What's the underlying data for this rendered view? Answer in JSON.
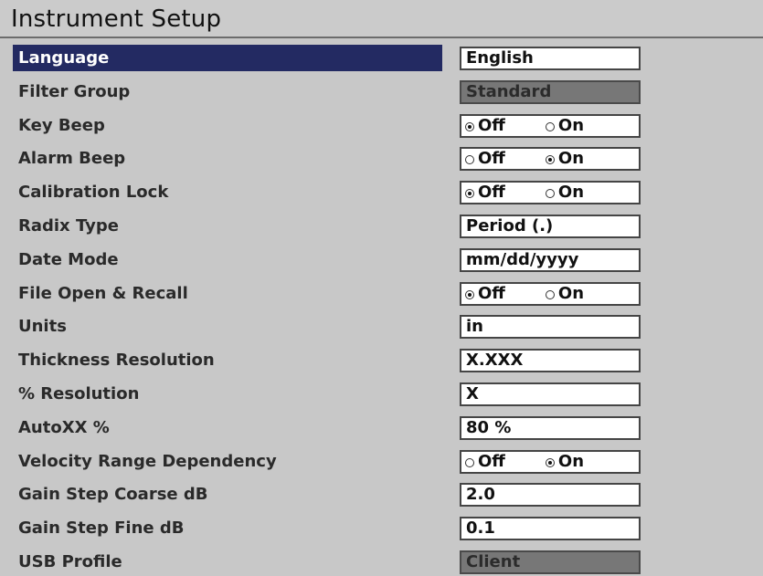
{
  "header": {
    "title": "Instrument Setup"
  },
  "settings": [
    {
      "label": "Language",
      "value": "English",
      "type": "text",
      "selected": true,
      "disabled": false
    },
    {
      "label": "Filter Group",
      "value": "Standard",
      "type": "text",
      "selected": false,
      "disabled": true
    },
    {
      "label": "Key Beep",
      "type": "radio",
      "selected": false,
      "disabled": false,
      "option_off": "Off",
      "option_on": "On",
      "checked": "Off"
    },
    {
      "label": "Alarm Beep",
      "type": "radio",
      "selected": false,
      "disabled": false,
      "option_off": "Off",
      "option_on": "On",
      "checked": "On"
    },
    {
      "label": "Calibration Lock",
      "type": "radio",
      "selected": false,
      "disabled": false,
      "option_off": "Off",
      "option_on": "On",
      "checked": "Off"
    },
    {
      "label": "Radix Type",
      "value": "Period (.)",
      "type": "text",
      "selected": false,
      "disabled": false
    },
    {
      "label": "Date Mode",
      "value": "mm/dd/yyyy",
      "type": "text",
      "selected": false,
      "disabled": false
    },
    {
      "label": "File Open & Recall",
      "type": "radio",
      "selected": false,
      "disabled": false,
      "option_off": "Off",
      "option_on": "On",
      "checked": "Off"
    },
    {
      "label": "Units",
      "value": "in",
      "type": "text",
      "selected": false,
      "disabled": false
    },
    {
      "label": "Thickness Resolution",
      "value": "X.XXX",
      "type": "text",
      "selected": false,
      "disabled": false
    },
    {
      "label": "% Resolution",
      "value": "X",
      "type": "text",
      "selected": false,
      "disabled": false
    },
    {
      "label": "AutoXX %",
      "value": "80 %",
      "type": "text",
      "selected": false,
      "disabled": false
    },
    {
      "label": "Velocity Range Dependency",
      "type": "radio",
      "selected": false,
      "disabled": false,
      "option_off": "Off",
      "option_on": "On",
      "checked": "On"
    },
    {
      "label": "Gain Step Coarse dB",
      "value": "2.0",
      "type": "text",
      "selected": false,
      "disabled": false
    },
    {
      "label": "Gain Step Fine dB",
      "value": "0.1",
      "type": "text",
      "selected": false,
      "disabled": false
    },
    {
      "label": "USB Profile",
      "value": "Client",
      "type": "text",
      "selected": false,
      "disabled": true
    }
  ]
}
